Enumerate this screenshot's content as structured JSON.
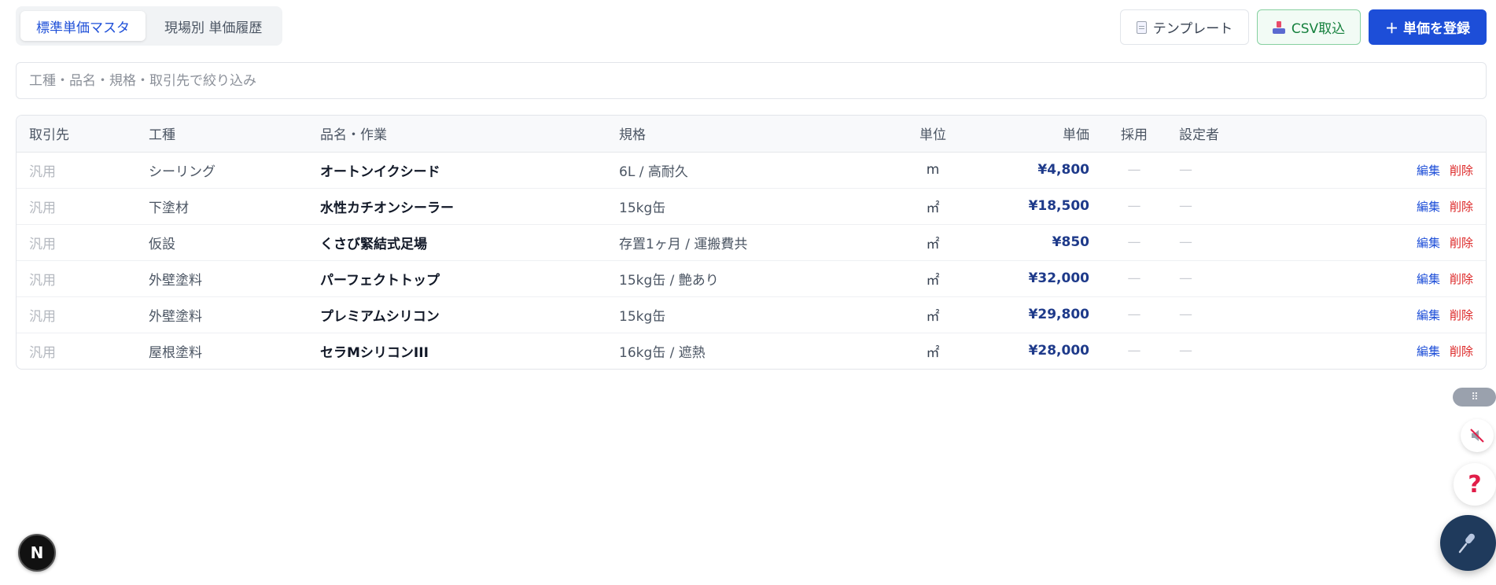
{
  "tabs": [
    {
      "label": "標準単価マスタ",
      "active": true
    },
    {
      "label": "現場別 単価履歴",
      "active": false
    }
  ],
  "actions": {
    "template_label": "テンプレート",
    "csv_label": "CSV取込",
    "register_label": "＋ 単価を登録"
  },
  "search": {
    "placeholder": "工種・品名・規格・取引先で絞り込み",
    "value": ""
  },
  "table": {
    "headers": {
      "partner": "取引先",
      "kind": "工種",
      "item": "品名・作業",
      "spec": "規格",
      "unit": "単位",
      "price": "単価",
      "adopt": "採用",
      "setter": "設定者"
    },
    "edit_label": "編集",
    "delete_label": "削除",
    "rows": [
      {
        "partner": "汎用",
        "kind": "シーリング",
        "item": "オートンイクシード",
        "spec": "6L / 高耐久",
        "unit": "m",
        "price": "¥4,800",
        "adopt": "—",
        "setter": "—"
      },
      {
        "partner": "汎用",
        "kind": "下塗材",
        "item": "水性カチオンシーラー",
        "spec": "15kg缶",
        "unit": "㎡",
        "price": "¥18,500",
        "adopt": "—",
        "setter": "—"
      },
      {
        "partner": "汎用",
        "kind": "仮設",
        "item": "くさび緊結式足場",
        "spec": "存置1ヶ月 / 運搬費共",
        "unit": "㎡",
        "price": "¥850",
        "adopt": "—",
        "setter": "—"
      },
      {
        "partner": "汎用",
        "kind": "外壁塗料",
        "item": "パーフェクトトップ",
        "spec": "15kg缶 / 艶あり",
        "unit": "㎡",
        "price": "¥32,000",
        "adopt": "—",
        "setter": "—"
      },
      {
        "partner": "汎用",
        "kind": "外壁塗料",
        "item": "プレミアムシリコン",
        "spec": "15kg缶",
        "unit": "㎡",
        "price": "¥29,800",
        "adopt": "—",
        "setter": "—"
      },
      {
        "partner": "汎用",
        "kind": "屋根塗料",
        "item": "セラMシリコンIII",
        "spec": "16kg缶 / 遮熱",
        "unit": "㎡",
        "price": "¥28,000",
        "adopt": "—",
        "setter": "—"
      }
    ]
  },
  "floating": {
    "help_glyph": "?",
    "next_glyph": "N",
    "handle_glyph": "⠿"
  }
}
